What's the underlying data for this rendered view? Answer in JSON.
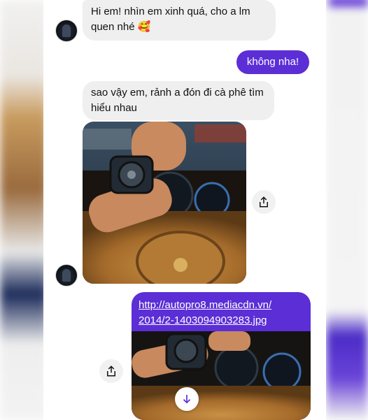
{
  "messages": {
    "incoming_1": "Hi em! nhìn em xinh quá, cho a lm quen nhé 🥰",
    "outgoing_1": "không nha!",
    "incoming_2": "sao vậy em, rảnh a đón đi cà phê tìm hiểu nhau",
    "outgoing_link_line1": "http://autopro8.mediacdn.vn/",
    "outgoing_link_line2": "2014/2-1403094903283.jpg"
  },
  "icons": {
    "share": "share-icon",
    "scroll_down": "arrow-down-icon",
    "avatar": "avatar"
  },
  "colors": {
    "outgoing_bubble": "#5b2ed6",
    "incoming_bubble": "#efefef",
    "background": "#ffffff"
  }
}
